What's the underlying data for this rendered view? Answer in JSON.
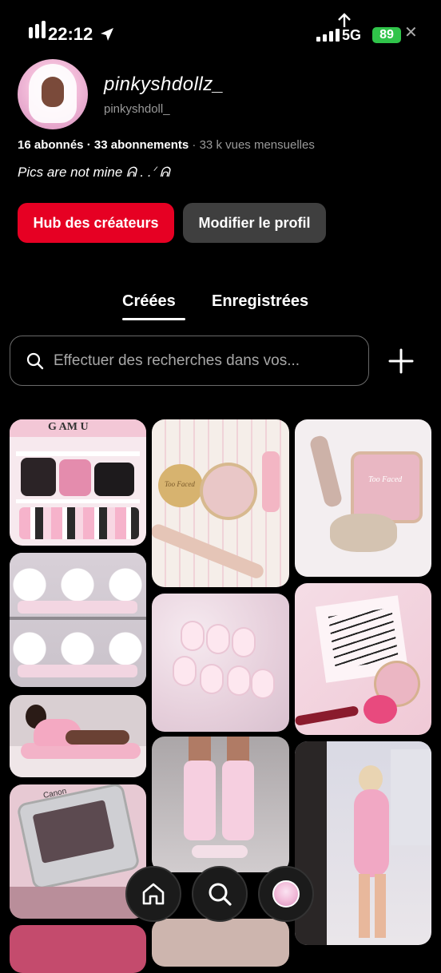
{
  "status_bar": {
    "time": "22:12",
    "network": "5G",
    "battery": "89"
  },
  "profile": {
    "username": "pinkyshdollz_",
    "handle": "pinkyshdoll_",
    "followers": "16 abonnés",
    "following": "33 abonnements",
    "monthly_views": "33 k vues mensuelles",
    "bio": "Pics are not mine ᕱ . .ᐟ ᕱ"
  },
  "buttons": {
    "creator_hub": "Hub des créateurs",
    "edit_profile": "Modifier le profil"
  },
  "tabs": [
    {
      "label": "Créées",
      "active": true
    },
    {
      "label": "Enregistrées",
      "active": false
    }
  ],
  "search": {
    "placeholder": "Effectuer des recherches dans vos..."
  },
  "pins": [
    {
      "label": "G AM U"
    },
    {
      "label": "Too Faced"
    },
    {
      "label": "Too Faced"
    },
    {
      "label": ""
    },
    {
      "label": ""
    },
    {
      "label": ""
    },
    {
      "label": ""
    },
    {
      "label": "Canon"
    },
    {
      "label": ""
    },
    {
      "label": ""
    }
  ],
  "nav": {
    "items": [
      "home-icon",
      "search-icon",
      "profile-avatar"
    ]
  },
  "colors": {
    "accent": "#e60023",
    "secondary_button": "#3f3f3f",
    "battery": "#30c44a"
  }
}
